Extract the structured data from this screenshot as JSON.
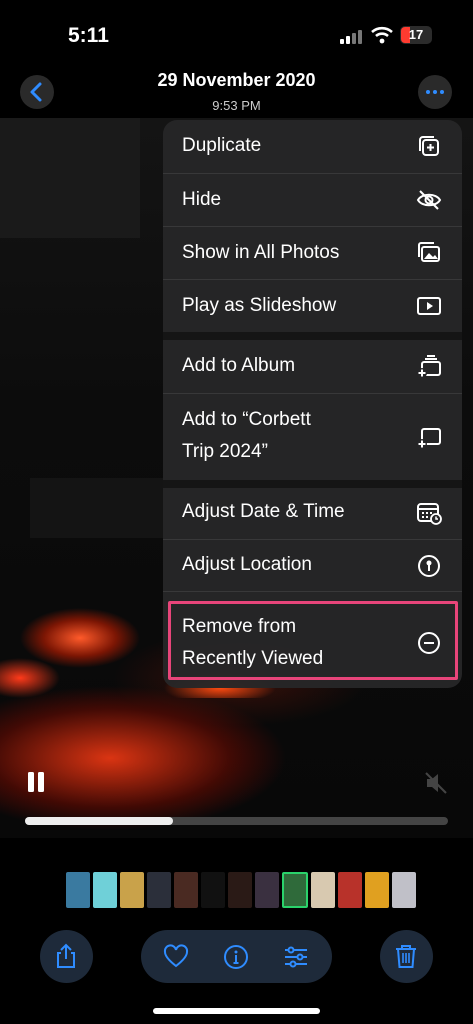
{
  "status_bar": {
    "time": "5:11",
    "battery": "17"
  },
  "header": {
    "date": "29 November 2020",
    "time": "9:53 PM"
  },
  "menu": {
    "items": [
      {
        "label": "Duplicate",
        "icon": "duplicate-icon"
      },
      {
        "label": "Hide",
        "icon": "eye-slash-icon"
      },
      {
        "label": "Show in All Photos",
        "icon": "photos-icon"
      },
      {
        "label": "Play as Slideshow",
        "icon": "play-rectangle-icon"
      },
      {
        "label": "Add to Album",
        "icon": "add-album-icon"
      },
      {
        "label": "Add to “Corbett Trip 2024”",
        "line1": "Add to “Corbett",
        "line2": "Trip 2024”",
        "icon": "add-to-album-icon"
      },
      {
        "label": "Adjust Date & Time",
        "icon": "calendar-clock-icon"
      },
      {
        "label": "Adjust Location",
        "icon": "location-icon"
      },
      {
        "label": "Remove from Recently Viewed",
        "line1": "Remove from",
        "line2": "Recently Viewed",
        "icon": "minus-circle-icon"
      }
    ],
    "highlight_color": "#e8457a"
  },
  "video": {
    "progress": 0.35
  },
  "thumbnails": [
    {
      "color": "#3a7aa0"
    },
    {
      "color": "#6fd0d8"
    },
    {
      "color": "#c9a24a"
    },
    {
      "color": "#2b2f3a"
    },
    {
      "color": "#4a2a22"
    },
    {
      "color": "#111"
    },
    {
      "color": "#2a1a16"
    },
    {
      "color": "#3a3040"
    },
    {
      "color": "#2f6a3a",
      "selected": true
    },
    {
      "color": "#d8c9b0"
    },
    {
      "color": "#b8322a"
    },
    {
      "color": "#e0a020"
    },
    {
      "color": "#c0c0c8"
    }
  ],
  "toolbar": {
    "accent": "#2f8cff"
  }
}
